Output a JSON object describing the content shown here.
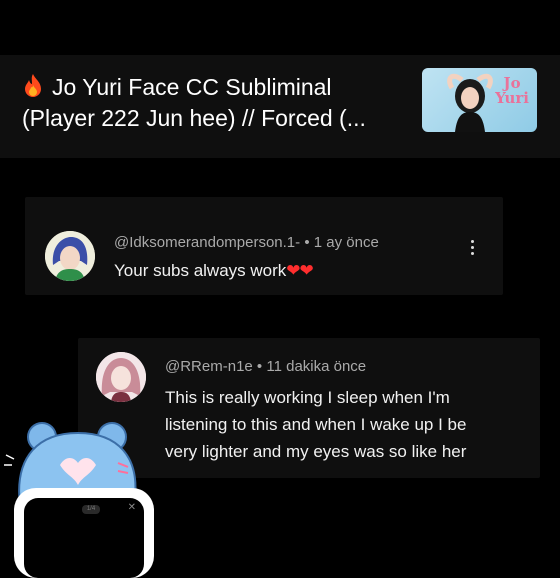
{
  "header": {
    "title_line1": "Jo Yuri Face CC Subliminal",
    "title_line2": "(Player 222 Jun hee) //  Forced (...",
    "thumbnail_logo_line1": "Jo",
    "thumbnail_logo_line2": "Yuri"
  },
  "comments": [
    {
      "handle": "@Idksomerandomperson.1-",
      "time": "1 ay önce",
      "text": "Your subs always work",
      "hearts": "❤❤"
    },
    {
      "handle": "@RRem-n1e",
      "time": "11 dakika önce",
      "text_lines": [
        "This is really working I sleep when I'm",
        "listening to this and when I wake up I be",
        "very lighter and my eyes was so like her"
      ]
    }
  ],
  "phone": {
    "badge": "1/4",
    "close": "✕"
  },
  "colors": {
    "background": "#000000",
    "card": "#0f0f0f",
    "heart": "#ff2e2e"
  },
  "icons": [
    "fire-icon",
    "more-vert-icon"
  ]
}
